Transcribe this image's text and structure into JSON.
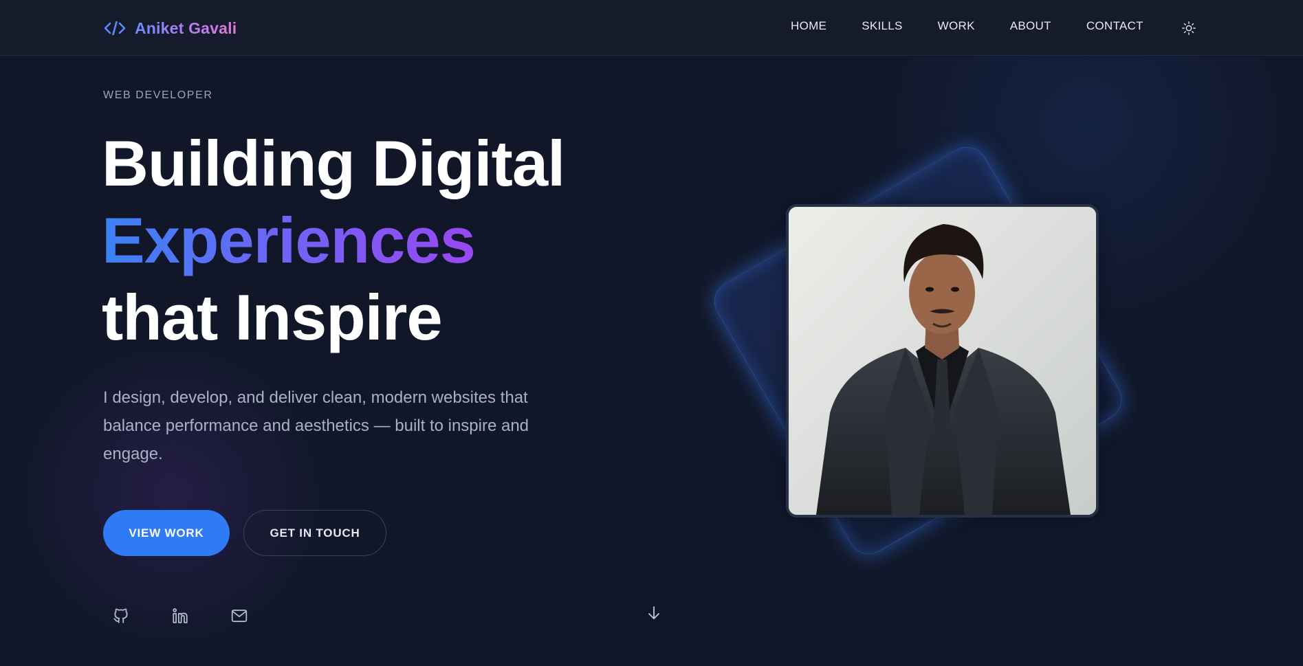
{
  "brand": {
    "name": "Aniket Gavali",
    "icon": "code-icon"
  },
  "nav": {
    "links": [
      "HOME",
      "SKILLS",
      "WORK",
      "ABOUT",
      "CONTACT"
    ],
    "theme_toggle_icon": "sun-icon"
  },
  "hero": {
    "eyebrow": "WEB DEVELOPER",
    "title_line1": "Building Digital",
    "title_line2": "Experiences",
    "title_line3": "that Inspire",
    "description": "I design, develop, and deliver clean, modern websites that balance performance and aesthetics — built to inspire and engage.",
    "primary_button": "VIEW WORK",
    "secondary_button": "GET IN TOUCH",
    "socials": [
      "github-icon",
      "linkedin-icon",
      "mail-icon"
    ],
    "scroll_icon": "arrow-down-icon"
  },
  "colors": {
    "background": "#111729",
    "accent": "#2f7bf6",
    "gradient_start": "#3b82f6",
    "gradient_end": "#a93cf0"
  }
}
